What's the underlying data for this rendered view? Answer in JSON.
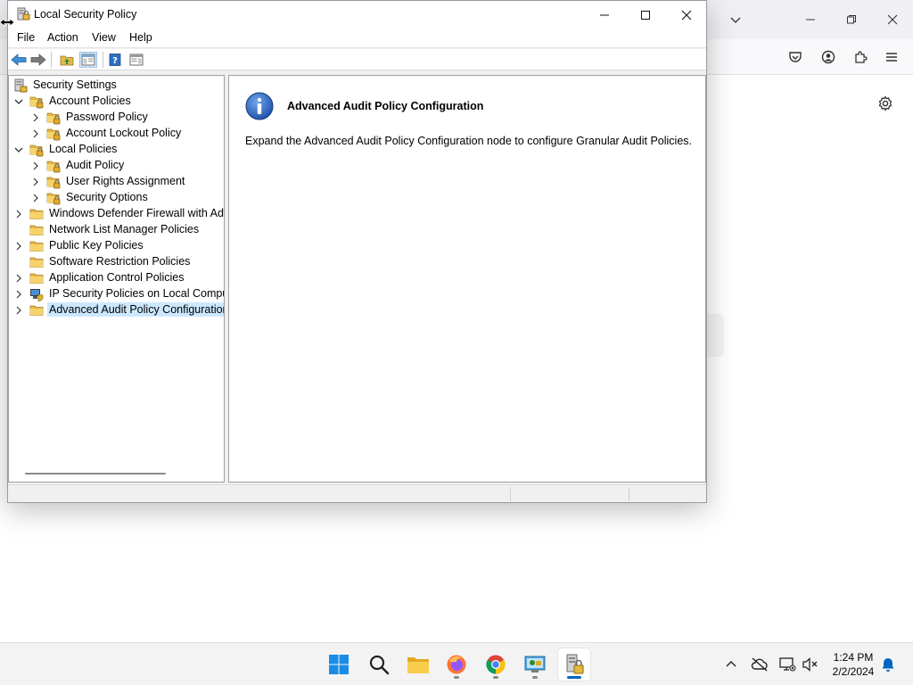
{
  "window": {
    "title": "Local Security Policy",
    "menu": [
      "File",
      "Action",
      "View",
      "Help"
    ]
  },
  "tree": {
    "items": [
      {
        "label": "Security Settings",
        "level": 0,
        "expander": "none",
        "icon": "security-settings-icon"
      },
      {
        "label": "Account Policies",
        "level": 1,
        "expander": "expanded",
        "icon": "policy-folder-icon"
      },
      {
        "label": "Password Policy",
        "level": 2,
        "expander": "collapsed",
        "icon": "policy-folder-icon"
      },
      {
        "label": "Account Lockout Policy",
        "level": 2,
        "expander": "collapsed",
        "icon": "policy-folder-icon"
      },
      {
        "label": "Local Policies",
        "level": 1,
        "expander": "expanded",
        "icon": "policy-folder-icon"
      },
      {
        "label": "Audit Policy",
        "level": 2,
        "expander": "collapsed",
        "icon": "policy-folder-icon"
      },
      {
        "label": "User Rights Assignment",
        "level": 2,
        "expander": "collapsed",
        "icon": "policy-folder-icon"
      },
      {
        "label": "Security Options",
        "level": 2,
        "expander": "collapsed",
        "icon": "policy-folder-icon"
      },
      {
        "label": "Windows Defender Firewall with Adva",
        "level": 1,
        "expander": "collapsed",
        "icon": "folder-icon"
      },
      {
        "label": "Network List Manager Policies",
        "level": 1,
        "expander": "none",
        "icon": "folder-icon"
      },
      {
        "label": "Public Key Policies",
        "level": 1,
        "expander": "collapsed",
        "icon": "folder-icon"
      },
      {
        "label": "Software Restriction Policies",
        "level": 1,
        "expander": "none",
        "icon": "folder-icon"
      },
      {
        "label": "Application Control Policies",
        "level": 1,
        "expander": "collapsed",
        "icon": "folder-icon"
      },
      {
        "label": "IP Security Policies on Local Compute",
        "level": 1,
        "expander": "collapsed",
        "icon": "ip-security-icon"
      },
      {
        "label": "Advanced Audit Policy Configuration",
        "level": 1,
        "expander": "collapsed",
        "icon": "folder-icon",
        "selected": true
      }
    ]
  },
  "result": {
    "title": "Advanced Audit Policy Configuration",
    "description": "Expand the Advanced Audit Policy Configuration node to configure Granular Audit Policies."
  },
  "taskbar": {
    "apps": [
      "start-icon",
      "search-icon",
      "file-explorer-icon",
      "firefox-icon",
      "chrome-icon",
      "control-panel-icon",
      "local-security-policy-icon"
    ],
    "time": "1:24 PM",
    "date": "2/2/2024"
  },
  "colors": {
    "selection": "#cce8ff",
    "accent": "#0067c0",
    "folder": "#f2c94c"
  }
}
